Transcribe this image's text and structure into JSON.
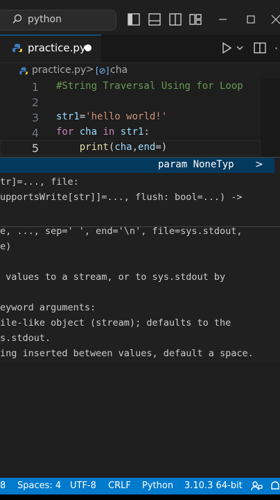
{
  "titlebar": {
    "search_text": "python"
  },
  "tab": {
    "label": "practice.py"
  },
  "breadcrumb": {
    "file": "practice.py",
    "separator": ">",
    "symbol_icon": "[⊘]",
    "symbol": "cha"
  },
  "editor": {
    "lines": [
      {
        "num": "1",
        "text": "#String Traversal Using for Loop"
      },
      {
        "num": "2",
        "text": ""
      },
      {
        "num": "3",
        "text": "str1='hello world!'"
      },
      {
        "num": "4",
        "text": "for cha in str1:"
      },
      {
        "num": "5",
        "text": "    print(cha,end=)"
      }
    ]
  },
  "hover": {
    "header": "param NoneTyp",
    "chevron": ">",
    "lines": [
      "tr]=..., file:",
      "upportsWrite[str]]=..., flush: bool=...) ->",
      "e, ..., sep=' ', end='\\n', file=sys.stdout,",
      "e)",
      " values to a stream, or to sys.stdout by",
      "eyword arguments:",
      "ile-like object (stream); defaults to the",
      "s.stdout.",
      "ing inserted between values, default a space."
    ]
  },
  "statusbar": {
    "col": "8",
    "spaces": "Spaces: 4",
    "encoding": "UTF-8",
    "eol": "CRLF",
    "language": "Python",
    "interpreter": "3.10.3 64-bit"
  },
  "colors": {
    "accent": "#007acc",
    "comment": "#6a9955",
    "string": "#ce9178",
    "keyword": "#c586c0",
    "function": "#dcdcaa"
  }
}
